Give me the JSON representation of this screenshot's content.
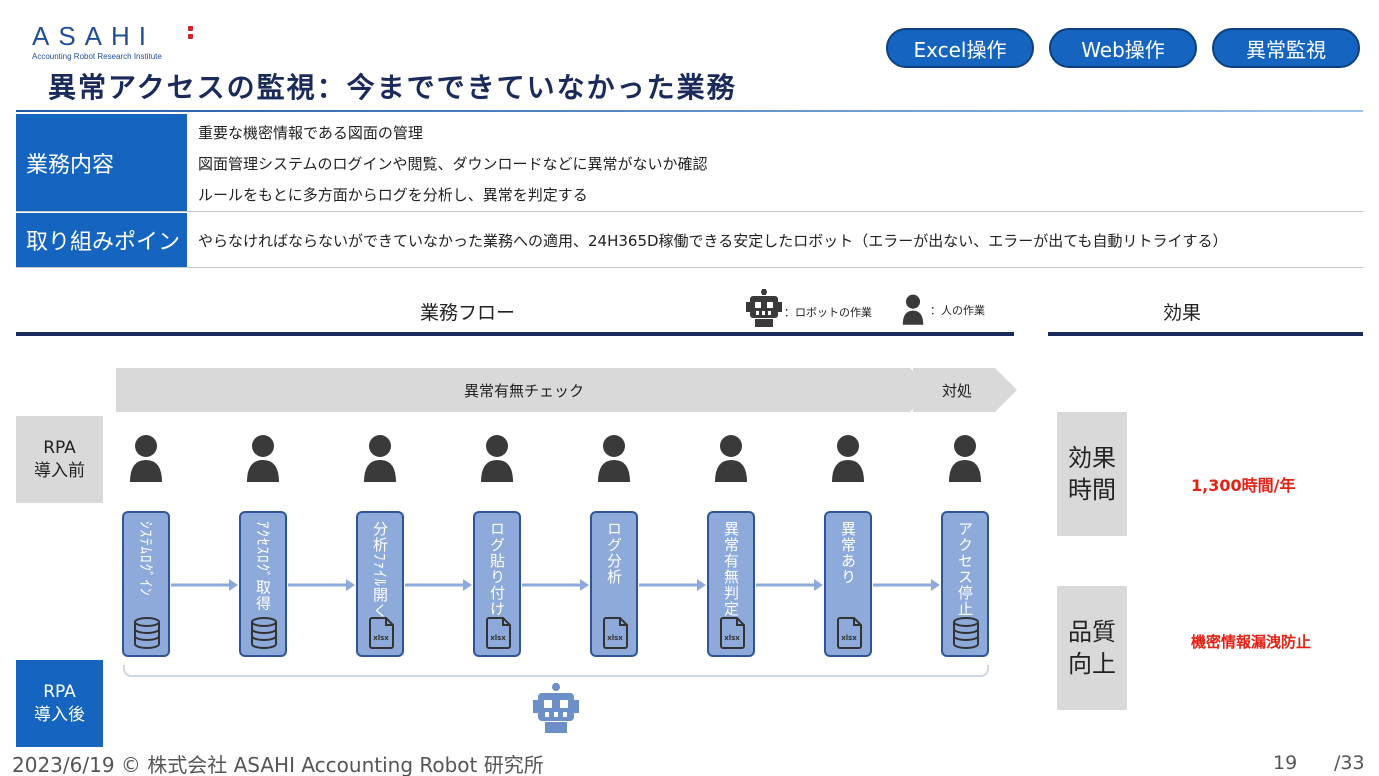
{
  "logo": {
    "word": "ASAHI",
    "subtitle": "Accounting Robot Research Institute"
  },
  "title": "異常アクセスの監視：今までできていなかった業務",
  "tags": [
    "Excel操作",
    "Web操作",
    "異常監視"
  ],
  "info": {
    "row1_label": "業務内容",
    "row1_lines": [
      "重要な機密情報である図面の管理",
      "図面管理システムのログインや閲覧、ダウンロードなどに異常がないか確認",
      "ルールをもとに多方面からログを分析し、異常を判定する"
    ],
    "row2_label": "取り組みポイント",
    "row2_text": "やらなければならないができていなかった業務への適用、24H365D稼働できる安定したロボット（エラーが出ない、エラーが出ても自動リトライする）"
  },
  "flow": {
    "heading": "業務フロー",
    "legend_robot": "：ロボットの作業",
    "legend_person": "：人の作業",
    "phase_check": "異常有無チェック",
    "phase_action": "対処",
    "before_label": "RPA\n導入前",
    "after_label": "RPA\n導入後",
    "steps": [
      {
        "label": "ｼｽﾃﾑﾛｸﾞｲﾝ",
        "icon": "database-icon"
      },
      {
        "label": "ｱｸｾｽﾛｸﾞ取得",
        "icon": "database-icon"
      },
      {
        "label": "分析ﾌｧｲﾙ開く",
        "icon": "xlsx-file-icon",
        "icon_text": "xlsx"
      },
      {
        "label": "ログ貼り付け",
        "icon": "xlsx-file-icon",
        "icon_text": "xlsx"
      },
      {
        "label": "ログ分析",
        "icon": "xlsx-file-icon",
        "icon_text": "xlsx"
      },
      {
        "label": "異常有無判定",
        "icon": "xlsx-file-icon",
        "icon_text": "xlsx"
      },
      {
        "label": "異常あり",
        "icon": "xlsx-file-icon",
        "icon_text": "xlsx"
      },
      {
        "label": "アクセス停止",
        "icon": "database-icon"
      }
    ]
  },
  "effect": {
    "heading": "効果",
    "time_label": "効果\n時間",
    "time_value": "1,300時間/年",
    "quality_label": "品質\n向上",
    "quality_value": "機密情報漏洩防止"
  },
  "footer": {
    "text": "2023/6/19 © 株式会社 ASAHI Accounting Robot 研究所",
    "page": "19",
    "total": "/33"
  },
  "colors": {
    "primary": "#1565c0",
    "navy": "#1a2a5a",
    "step_fill": "#8eaadb",
    "step_border": "#2f5597",
    "accent_red": "#e32214",
    "gray": "#d9d9d9"
  }
}
